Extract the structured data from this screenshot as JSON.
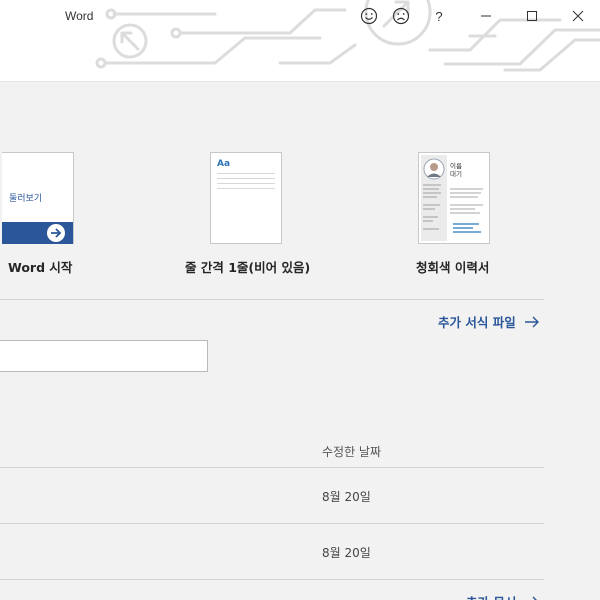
{
  "window": {
    "app_name": "Word",
    "smile_icon": "smile-icon",
    "frown_icon": "frown-icon",
    "help_label": "?"
  },
  "templates": [
    {
      "label": "Word 시작",
      "thumbnail_text": "둘러보기",
      "accent": "#2b579a"
    },
    {
      "label": "줄 간격 1줄(비어 있음)",
      "thumbnail_text": "Aa",
      "accent": "#2e74b5"
    },
    {
      "label": "청회색 이력서",
      "thumbnail_text": "이름\n대기",
      "accent": "#4a90c9"
    }
  ],
  "more_templates_label": "추가 서식 파일",
  "search": {
    "value": "",
    "placeholder": ""
  },
  "recent": {
    "modified_header": "수정한 날짜",
    "rows": [
      {
        "modified": "8월 20일"
      },
      {
        "modified": "8월 20일"
      }
    ]
  },
  "more_documents_label": "추가 문서",
  "colors": {
    "accent": "#2b579a",
    "background": "#f2f2f2"
  }
}
